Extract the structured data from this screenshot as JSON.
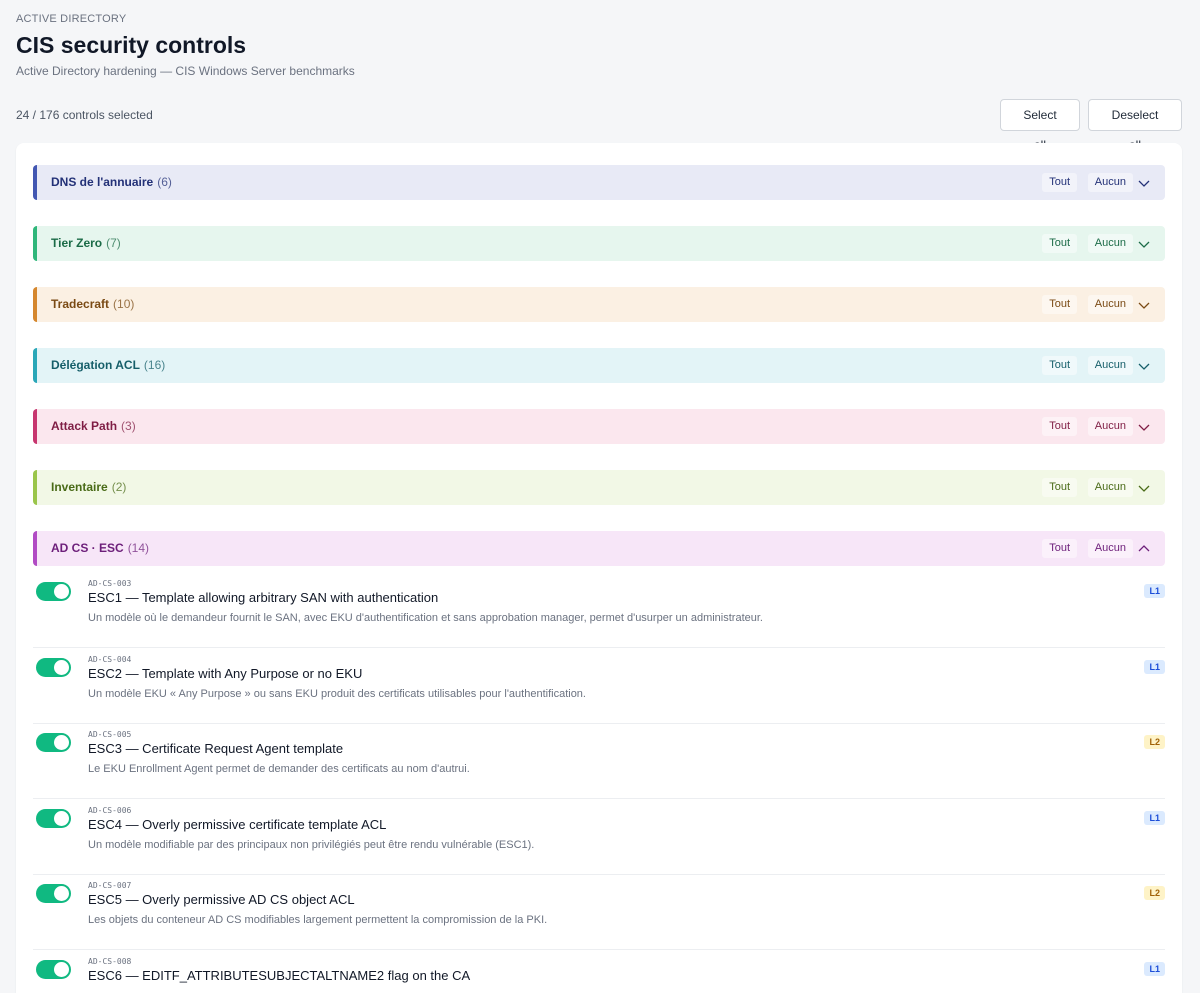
{
  "header": {
    "eyebrow": "ACTIVE DIRECTORY",
    "title": "CIS security controls",
    "subtitle": "Active Directory hardening — CIS Windows Server benchmarks",
    "selection_count": "24 / 176 controls selected",
    "select_all_label": "Select all",
    "deselect_all_label": "Deselect all"
  },
  "groups": [
    {
      "name": "DNS de l'annuaire",
      "count": "(6)",
      "tout": "Tout",
      "aucun": "Aucun",
      "expanded": false,
      "accent": "#4257b2",
      "bg": "#e8eaf6",
      "text": "#233177"
    },
    {
      "name": "Tier Zero",
      "count": "(7)",
      "tout": "Tout",
      "aucun": "Aucun",
      "expanded": false,
      "accent": "#2fb67a",
      "bg": "#e6f6ee",
      "text": "#1b6b47"
    },
    {
      "name": "Tradecraft",
      "count": "(10)",
      "tout": "Tout",
      "aucun": "Aucun",
      "expanded": false,
      "accent": "#d5872e",
      "bg": "#fbf0e3",
      "text": "#7a4a14"
    },
    {
      "name": "Délégation ACL",
      "count": "(16)",
      "tout": "Tout",
      "aucun": "Aucun",
      "expanded": false,
      "accent": "#2aa7b8",
      "bg": "#e3f4f7",
      "text": "#155e69"
    },
    {
      "name": "Attack Path",
      "count": "(3)",
      "tout": "Tout",
      "aucun": "Aucun",
      "expanded": false,
      "accent": "#c7366f",
      "bg": "#fbe7ee",
      "text": "#7f1d44"
    },
    {
      "name": "Inventaire",
      "count": "(2)",
      "tout": "Tout",
      "aucun": "Aucun",
      "expanded": false,
      "accent": "#9ac54a",
      "bg": "#f2f8e6",
      "text": "#4a6b18"
    },
    {
      "name": "AD CS · ESC",
      "count": "(14)",
      "tout": "Tout",
      "aucun": "Aucun",
      "expanded": true,
      "accent": "#b14bc4",
      "bg": "#f7e6f8",
      "text": "#6d1f7a"
    }
  ],
  "controls": [
    {
      "id": "AD-CS-003",
      "title": "ESC1 — Template allowing arbitrary SAN with authentication",
      "desc": "Un modèle où le demandeur fournit le SAN, avec EKU d'authentification et sans approbation manager, permet d'usurper un administrateur.",
      "level": "L1",
      "enabled": true
    },
    {
      "id": "AD-CS-004",
      "title": "ESC2 — Template with Any Purpose or no EKU",
      "desc": "Un modèle EKU « Any Purpose » ou sans EKU produit des certificats utilisables pour l'authentification.",
      "level": "L1",
      "enabled": true
    },
    {
      "id": "AD-CS-005",
      "title": "ESC3 — Certificate Request Agent template",
      "desc": "Le EKU Enrollment Agent permet de demander des certificats au nom d'autrui.",
      "level": "L2",
      "enabled": true
    },
    {
      "id": "AD-CS-006",
      "title": "ESC4 — Overly permissive certificate template ACL",
      "desc": "Un modèle modifiable par des principaux non privilégiés peut être rendu vulnérable (ESC1).",
      "level": "L1",
      "enabled": true
    },
    {
      "id": "AD-CS-007",
      "title": "ESC5 — Overly permissive AD CS object ACL",
      "desc": "Les objets du conteneur AD CS modifiables largement permettent la compromission de la PKI.",
      "level": "L2",
      "enabled": true
    },
    {
      "id": "AD-CS-008",
      "title": "ESC6 — EDITF_ATTRIBUTESUBJECTALTNAME2 flag on the CA",
      "desc": "",
      "level": "L1",
      "enabled": true
    }
  ],
  "colors": {
    "toggle_on": "#10b981",
    "badge_l1_bg": "#dbeafe",
    "badge_l2_bg": "#fef3c7"
  }
}
